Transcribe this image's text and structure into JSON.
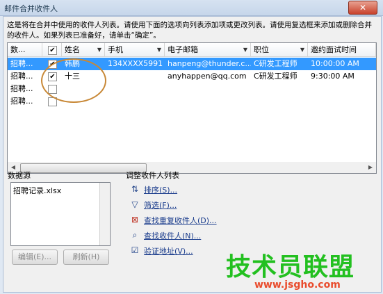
{
  "window": {
    "title": "邮件合并收件人",
    "close_glyph": "✕"
  },
  "intro": "这是将在合并中使用的收件人列表。请使用下面的选项向列表添加项或更改列表。请使用复选框来添加或删除合并的收件人。如果列表已准备好，请单击“确定”。",
  "columns": [
    "数...",
    "",
    "姓名",
    "手机",
    "电子邮箱",
    "职位",
    "邀约面试时间"
  ],
  "rows": [
    {
      "source": "招聘...",
      "checked": true,
      "name": "韩鹏",
      "phone": "134XXXX5991",
      "email": "hanpeng@thunder.c...",
      "position": "C研发工程师",
      "time": "10:00:00 AM",
      "selected": true
    },
    {
      "source": "招聘...",
      "checked": true,
      "name": "十三",
      "phone": "",
      "email": "anyhappen@qq.com",
      "position": "C研发工程师",
      "time": "9:30:00 AM",
      "selected": false
    },
    {
      "source": "招聘...",
      "checked": false,
      "name": "",
      "phone": "",
      "email": "",
      "position": "",
      "time": "",
      "selected": false
    },
    {
      "source": "招聘...",
      "checked": false,
      "name": "",
      "phone": "",
      "email": "",
      "position": "",
      "time": "",
      "selected": false
    }
  ],
  "data_source": {
    "label": "数据源",
    "items": [
      "招聘记录.xlsx"
    ],
    "edit_button": "编辑(E)...",
    "refresh_button": "刷新(H)"
  },
  "adjust": {
    "label": "调整收件人列表",
    "links": [
      "排序(S)...",
      "筛选(F)...",
      "查找重复收件人(D)...",
      "查找收件人(N)...",
      "验证地址(V)..."
    ]
  },
  "watermark": {
    "text": "技术员联盟",
    "url": "www.jsgho.com"
  },
  "colors": {
    "selection": "#3399ff",
    "annotation": "#c88836",
    "watermark": "#23c020"
  }
}
